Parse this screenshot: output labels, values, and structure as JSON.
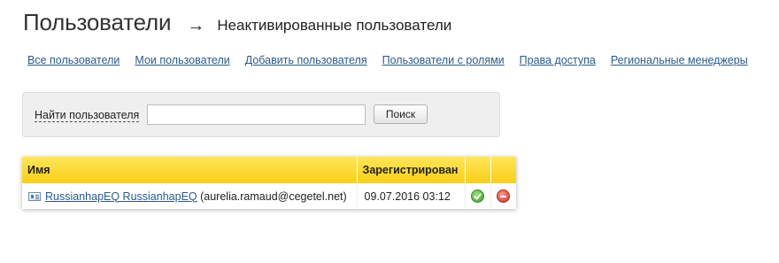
{
  "header": {
    "title": "Пользователи",
    "arrow": "→",
    "subtitle": "Неактивированные пользователи"
  },
  "nav": {
    "items": [
      {
        "label": "Все пользователи"
      },
      {
        "label": "Мои пользователи"
      },
      {
        "label": "Добавить пользователя"
      },
      {
        "label": "Пользователи с ролями"
      },
      {
        "label": "Права доступа"
      },
      {
        "label": "Региональные менеджеры"
      }
    ]
  },
  "search": {
    "label": "Найти пользователя",
    "value": "",
    "placeholder": "",
    "button_label": "Поиск"
  },
  "table": {
    "columns": {
      "name": "Имя",
      "registered": "Зарегистрирован",
      "activate": "",
      "delete": ""
    },
    "rows": [
      {
        "name": "RussianhapEQ RussianhapEQ",
        "email": "(aurelia.ramaud@cegetel.net)",
        "registered": "09.07.2016 03:12",
        "activate_icon": "check-circle-icon",
        "delete_icon": "minus-circle-icon"
      }
    ]
  },
  "colors": {
    "link": "#2a5a8c",
    "table_header_top": "#ffe55a",
    "table_header_bottom": "#f9cf17",
    "panel_bg": "#efefef",
    "ok_green": "#3f9b2b",
    "delete_red": "#cf2f22"
  }
}
